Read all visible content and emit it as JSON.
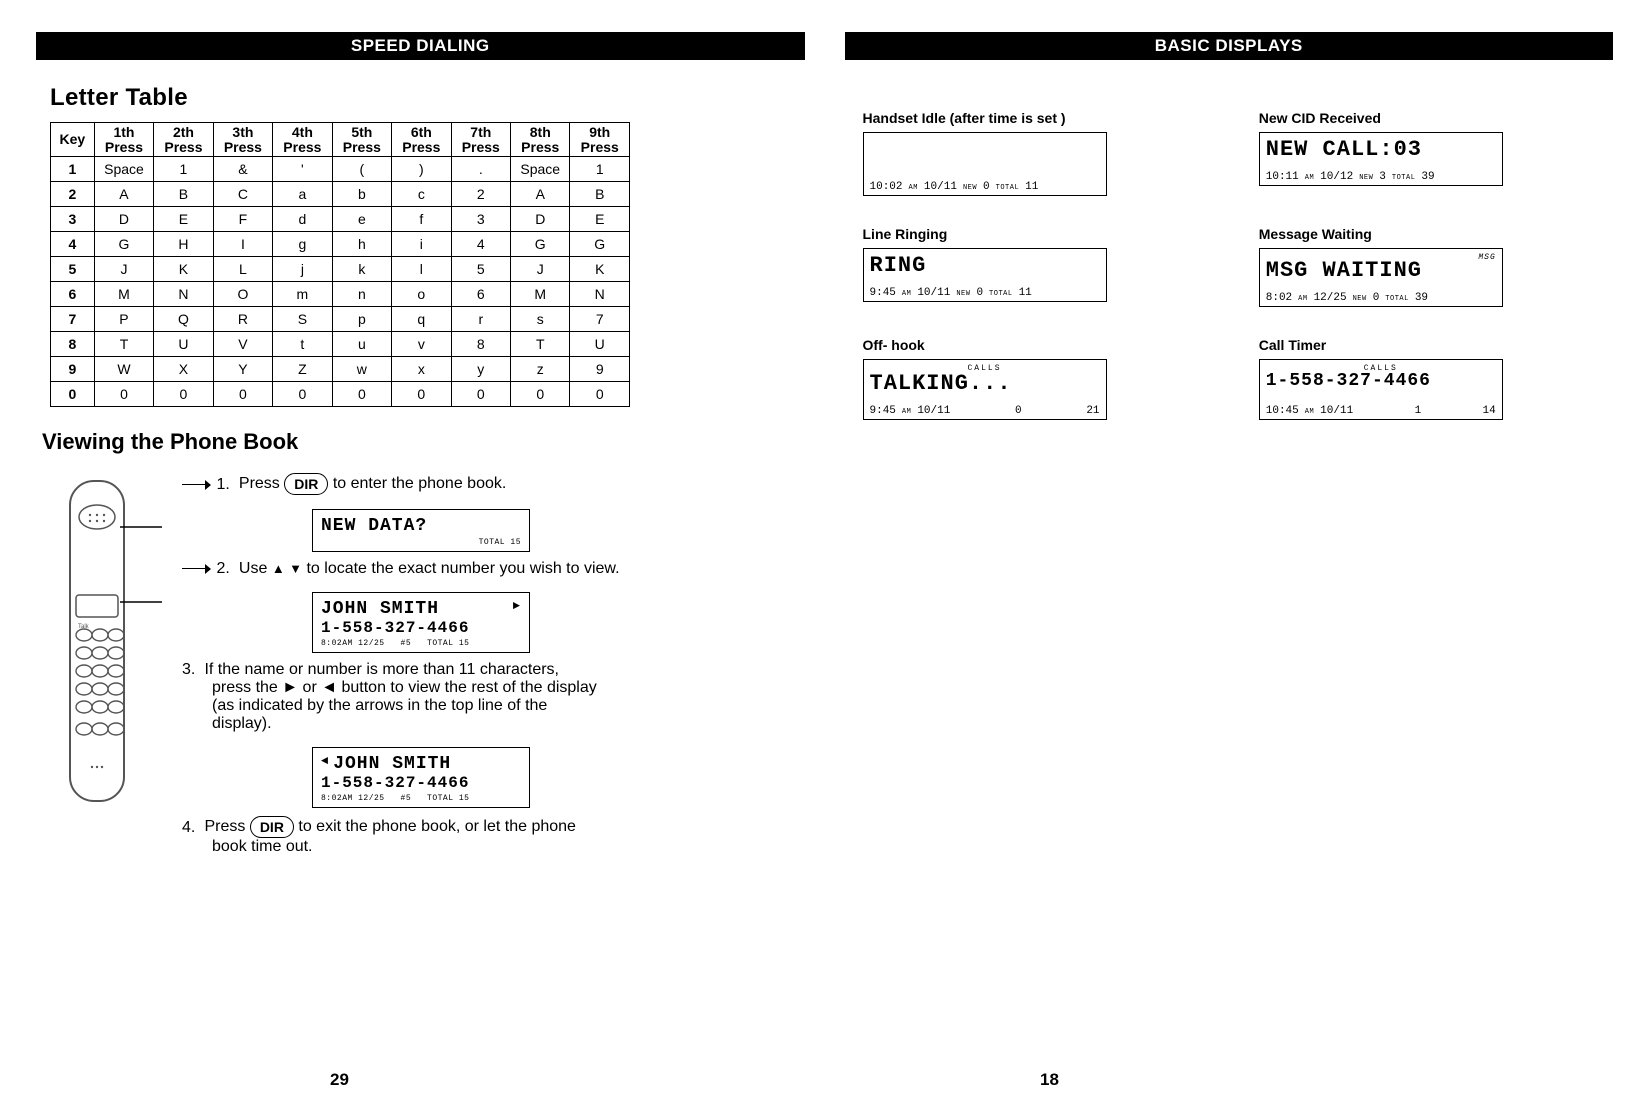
{
  "left": {
    "bar": "SPEED DIALING",
    "letter_table_title": "Letter Table",
    "letter_table": {
      "headers": [
        "Key",
        "1th\nPress",
        "2th\nPress",
        "3th\nPress",
        "4th\nPress",
        "5th\nPress",
        "6th\nPress",
        "7th\nPress",
        "8th\nPress",
        "9th\nPress"
      ],
      "rows": [
        [
          "1",
          "Space",
          "1",
          "&",
          "'",
          "(",
          ")",
          ".",
          "Space",
          "1"
        ],
        [
          "2",
          "A",
          "B",
          "C",
          "a",
          "b",
          "c",
          "2",
          "A",
          "B"
        ],
        [
          "3",
          "D",
          "E",
          "F",
          "d",
          "e",
          "f",
          "3",
          "D",
          "E"
        ],
        [
          "4",
          "G",
          "H",
          "I",
          "g",
          "h",
          "i",
          "4",
          "G",
          "G"
        ],
        [
          "5",
          "J",
          "K",
          "L",
          "j",
          "k",
          "l",
          "5",
          "J",
          "K"
        ],
        [
          "6",
          "M",
          "N",
          "O",
          "m",
          "n",
          "o",
          "6",
          "M",
          "N"
        ],
        [
          "7",
          "P",
          "Q",
          "R",
          "S",
          "p",
          "q",
          "r",
          "s",
          "7"
        ],
        [
          "8",
          "T",
          "U",
          "V",
          "t",
          "u",
          "v",
          "8",
          "T",
          "U"
        ],
        [
          "9",
          "W",
          "X",
          "Y",
          "Z",
          "w",
          "x",
          "y",
          "z",
          "9"
        ],
        [
          "0",
          "0",
          "0",
          "0",
          "0",
          "0",
          "0",
          "0",
          "0",
          "0"
        ]
      ]
    },
    "phone_book_title": "Viewing the Phone Book",
    "steps": {
      "s1": {
        "num": "1.",
        "pre": "Press",
        "btn": "DIR",
        "post": "to enter the phone book."
      },
      "lcd1": {
        "l1": "NEW DATA?",
        "sm": "TOTAL 15"
      },
      "s2": {
        "num": "2.",
        "pre": "Use",
        "post": "to locate the exact number you wish to view."
      },
      "lcd2": {
        "l1": "JOHN SMITH",
        "arrow": "►",
        "l2": "1-558-327-4466",
        "sm": "8:02AM 12/25   #5   TOTAL 15"
      },
      "s3": {
        "num": "3.",
        "line1": "If the name or number is more than 11 characters,",
        "line2": "press the ► or ◄ button to view the rest of the display",
        "line3": "(as indicated by the arrows in the top line of the",
        "line4": "display)."
      },
      "lcd3": {
        "l1": "JOHN SMITH",
        "arrow": "◄",
        "l2": "1-558-327-4466",
        "sm": "8:02AM 12/25   #5   TOTAL 15"
      },
      "s4": {
        "num": "4.",
        "pre": "Press",
        "btn": "DIR",
        "post": "to exit the phone book, or let the phone",
        "post2": "book time out."
      }
    },
    "page_num": "29"
  },
  "right": {
    "bar": "BASIC DISPLAYS",
    "cards": {
      "idle": {
        "caption": "Handset Idle (after time is set )",
        "top": "",
        "time": "10:02",
        "ampm": "AM",
        "date": "10/11",
        "new_lbl": "NEW",
        "new": "0",
        "total_lbl": "TOTAL",
        "total": "11"
      },
      "newcid": {
        "caption": "New CID Received",
        "top": "NEW CALL:03",
        "time": "10:11",
        "ampm": "AM",
        "date": "10/12",
        "new_lbl": "NEW",
        "new": "3",
        "total_lbl": "TOTAL",
        "total": "39"
      },
      "ring": {
        "caption": "Line Ringing",
        "top": "RING",
        "time": "9:45",
        "ampm": "AM",
        "date": "10/11",
        "new_lbl": "NEW",
        "new": "0",
        "total_lbl": "TOTAL",
        "total": "11"
      },
      "msgw": {
        "caption": "Message Waiting",
        "msgtag": "MSG",
        "top": "MSG WAITING",
        "time": "8:02",
        "ampm": "AM",
        "date": "12/25",
        "new_lbl": "NEW",
        "new": "0",
        "total_lbl": "TOTAL",
        "total": "39"
      },
      "offhook": {
        "caption": "Off- hook",
        "overline": "CALLS",
        "top": "TALKING...",
        "time": "9:45",
        "ampm": "AM",
        "date": "10/11",
        "v1": "0",
        "v2": "21"
      },
      "timer": {
        "caption": "Call Timer",
        "overline": "CALLS",
        "top": "1-558-327-4466",
        "time": "10:45",
        "ampm": "AM",
        "date": "10/11",
        "v1": "1",
        "v2": "14"
      }
    },
    "page_num": "18"
  }
}
